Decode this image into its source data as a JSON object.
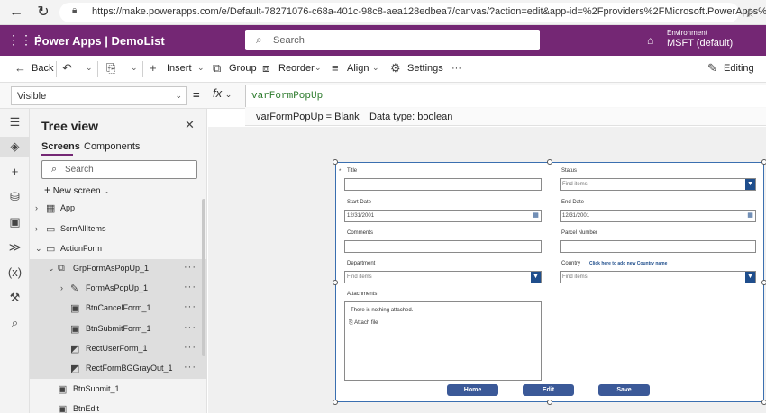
{
  "browser": {
    "url": "https://make.powerapps.com/e/Default-78271076-c68a-401c-98c8-aea128edbea7/canvas/?action=edit&app-id=%2Fproviders%2FMicrosoft.PowerApps%2Fa..."
  },
  "header": {
    "app_title": "Power Apps  |  DemoList",
    "search_placeholder": "Search",
    "env_label": "Environment",
    "env_value": "MSFT (default)"
  },
  "command_bar": {
    "back": "Back",
    "insert": "Insert",
    "group": "Group",
    "reorder": "Reorder",
    "align": "Align",
    "settings": "Settings",
    "more": "···",
    "editing": "Editing"
  },
  "formula_bar": {
    "property": "Visible",
    "equals": "=",
    "fx": "fx",
    "formula": "varFormPopUp",
    "result_text": "varFormPopUp  =  Blank",
    "result_type": "Data type: boolean"
  },
  "tree_view": {
    "title": "Tree view",
    "tabs": [
      "Screens",
      "Components"
    ],
    "search_placeholder": "Search",
    "new_screen": "New screen",
    "items": [
      {
        "label": "App",
        "level": 0
      },
      {
        "label": "ScrnAllItems",
        "level": 0
      },
      {
        "label": "ActionForm",
        "level": 0
      },
      {
        "label": "GrpFormAsPopUp_1",
        "level": 1
      },
      {
        "label": "FormAsPopUp_1",
        "level": 2
      },
      {
        "label": "BtnCancelForm_1",
        "level": 2
      },
      {
        "label": "BtnSubmitForm_1",
        "level": 2
      },
      {
        "label": "RectUserForm_1",
        "level": 2
      },
      {
        "label": "RectFormBGGrayOut_1",
        "level": 2
      },
      {
        "label": "BtnSubmit_1",
        "level": 1
      },
      {
        "label": "BtnEdit",
        "level": 1
      }
    ],
    "more_label": "···"
  },
  "form": {
    "required_marker": "*",
    "title_label": "Title",
    "status_label": "Status",
    "status_placeholder": "Find items",
    "start_date_label": "Start Date",
    "start_date_value": "12/31/2001",
    "end_date_label": "End Date",
    "end_date_value": "12/31/2001",
    "comments_label": "Comments",
    "parcel_label": "Parcel Number",
    "department_label": "Department",
    "department_placeholder": "Find items",
    "country_label": "Country",
    "country_link": "Click here to add new Country name",
    "country_placeholder": "Find items",
    "attachments_label": "Attachments",
    "attachments_empty": "There is nothing attached.",
    "attach_file": "Attach file",
    "buttons": [
      "Home",
      "Edit",
      "Save"
    ]
  },
  "colors": {
    "header_bg": "#742774",
    "form_button": "#3b5998",
    "dropdown_button": "#1f4e8c"
  }
}
